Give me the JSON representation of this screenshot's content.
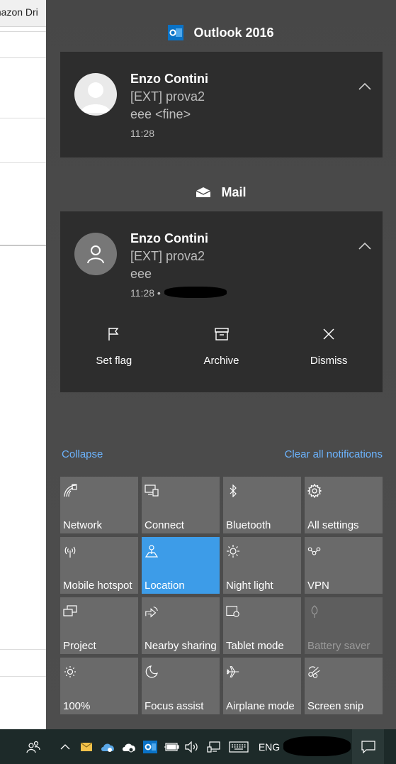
{
  "background_window": {
    "tab_title": "mazon Dri"
  },
  "groups": [
    {
      "app_name": "Outlook 2016",
      "app_icon": "outlook-icon",
      "notification": {
        "sender": "Enzo Contini",
        "subject": "[EXT] prova2",
        "body": "eee <fine>",
        "time": "11:28",
        "expand_icon": "chevron-up-icon"
      }
    },
    {
      "app_name": "Mail",
      "app_icon": "mail-icon",
      "notification": {
        "sender": "Enzo Contini",
        "subject": "[EXT] prova2",
        "body": "eee",
        "time": "11:28 •",
        "expand_icon": "chevron-up-icon",
        "actions": [
          {
            "label": "Set flag",
            "icon": "flag-icon"
          },
          {
            "label": "Archive",
            "icon": "archive-icon"
          },
          {
            "label": "Dismiss",
            "icon": "close-icon"
          }
        ]
      }
    }
  ],
  "links": {
    "collapse": "Collapse",
    "clear_all": "Clear all notifications"
  },
  "quick_actions": [
    {
      "label": "Network",
      "icon": "network-icon",
      "state": "off"
    },
    {
      "label": "Connect",
      "icon": "connect-icon",
      "state": "off"
    },
    {
      "label": "Bluetooth",
      "icon": "bluetooth-icon",
      "state": "off"
    },
    {
      "label": "All settings",
      "icon": "gear-icon",
      "state": "off"
    },
    {
      "label": "Mobile hotspot",
      "icon": "hotspot-icon",
      "state": "off"
    },
    {
      "label": "Location",
      "icon": "location-icon",
      "state": "on"
    },
    {
      "label": "Night light",
      "icon": "night-light-icon",
      "state": "off"
    },
    {
      "label": "VPN",
      "icon": "vpn-icon",
      "state": "off"
    },
    {
      "label": "Project",
      "icon": "project-icon",
      "state": "off"
    },
    {
      "label": "Nearby sharing",
      "icon": "nearby-sharing-icon",
      "state": "off"
    },
    {
      "label": "Tablet mode",
      "icon": "tablet-mode-icon",
      "state": "off"
    },
    {
      "label": "Battery saver",
      "icon": "battery-saver-icon",
      "state": "disabled"
    },
    {
      "label": "100%",
      "icon": "brightness-icon",
      "state": "off"
    },
    {
      "label": "Focus assist",
      "icon": "moon-icon",
      "state": "off"
    },
    {
      "label": "Airplane mode",
      "icon": "airplane-icon",
      "state": "off"
    },
    {
      "label": "Screen snip",
      "icon": "screen-snip-icon",
      "state": "off"
    }
  ],
  "taskbar": {
    "language": "ENG",
    "icons": [
      "people-icon",
      "show-hidden-icons-icon",
      "mail-tray-icon",
      "onedrive-icon",
      "onedrive-business-icon",
      "outlook-tray-icon",
      "battery-icon",
      "volume-icon",
      "network-tray-icon",
      "keyboard-icon",
      "notification-center-icon"
    ]
  },
  "colors": {
    "panel": "#474747",
    "card": "#2d2d2d",
    "tile": "#6a6a6a",
    "tile_active": "#3d9ce8",
    "link": "#6cb4ff",
    "taskbar": "#1d2a29"
  }
}
